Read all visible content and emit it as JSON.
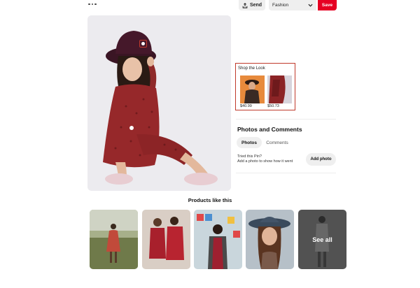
{
  "header": {
    "more_icon": "ellipsis-icon",
    "send_label": "Send",
    "send_icon": "share-upload-icon",
    "board_value": "Fashion",
    "board_icon": "chevron-down-icon",
    "save_label": "Save",
    "accent_color": "#e60023"
  },
  "pin": {
    "image_subject": "woman in black hat and red printed dress sitting on floor",
    "tag_color": "#c0392b"
  },
  "shop_the_look": {
    "title": "Shop the Look",
    "items": [
      {
        "price": "$40.99"
      },
      {
        "price": "$50.73"
      }
    ]
  },
  "photos_comments": {
    "title": "Photos and Comments",
    "tabs": [
      {
        "label": "Photos",
        "active": true
      },
      {
        "label": "Comments",
        "active": false
      }
    ],
    "tried_line1": "Tried this Pin?",
    "tried_line2": "Add a photo to show how it went",
    "add_photo_label": "Add photo"
  },
  "products": {
    "title": "Products like this",
    "see_all_label": "See all"
  }
}
